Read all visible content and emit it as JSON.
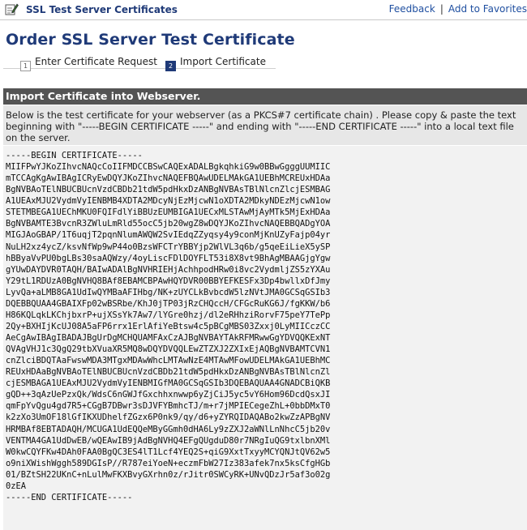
{
  "header": {
    "app_title": "SSL Test Server Certificates",
    "links": [
      "Feedback",
      "Add to Favorites"
    ]
  },
  "page": {
    "title": "Order SSL Server Test Certificate"
  },
  "steps": [
    {
      "number": "1",
      "label": "Enter Certificate Request",
      "active": false
    },
    {
      "number": "2",
      "label": "Import Certificate",
      "active": true
    }
  ],
  "section": {
    "title": "Import Certificate into Webserver.",
    "description": "Below is the test certificate for your webserver (as a PKCS#7 certificate chain) . Please copy & paste the text beginning with \"-----BEGIN CERTIFICATE -----\" and ending with \"-----END CERTIFICATE -----\" into a local text file on the server."
  },
  "certificate": {
    "lines": [
      "-----BEGIN CERTIFICATE-----",
      "MIIFPwYJKoZIhvcNAQcCoIIFMDCCBSwCAQExADALBgkqhkiG9w0BBwGgggUUMIIC",
      "mTCCAgKgAwIBAgICRyEwDQYJKoZIhvcNAQEFBQAwUDELMAkGA1UEBhMCREUxHDAa",
      "BgNVBAoTElNBUCBUcnVzdCBDb21tdW5pdHkxDzANBgNVBAsTBlNlcnZlcjESMBAG",
      "A1UEAxMJU2VydmVyIENBMB4XDTA2MDcyNjEzMjcwN1oXDTA2MDkyNDEzMjcwN1ow",
      "STETMBEGA1UEChMKU0FQIFdlYiBBUzEUMBIGA1UECxMLSTAwMjAyMTk5MjExHDAa",
      "BgNVBAMTE3BvcnR3ZWluLmRld55ocC5jb20wgZ8wDQYJKoZIhvcNAQEBBQADgYOA",
      "MIGJAoGBAP/1T6uqjT2pqnNlumAWQW2SvIEdqZZyqsy4y9conMjKnUZyFajp04yr",
      "NuLH2xz4ycZ/ksvNfWp9wP44o0BzsWFCTrYBBYjp2WlVL3q6b/g5qeEiLieX5ySP",
      "hBByaVvPU0bgLBs30saAQWzy/4oyLiscFDlDOYFLT53i8X8vt9BhAgMBAAGjgYgw",
      "gYUwDAYDVR0TAQH/BAIwADAlBgNVHRIEHjAchhpodHRw0i8vc2VydmljZS5zYXAu",
      "Y29tL1RDUzA0BgNVHQ8BAf8EBAMCBPAwHQYDVR00BBYEFKESFx3Dp4bwllxDfJmy",
      "LyvQa+aLMB8GA1UdIwQYMBaAFIHbg/NK+zUYCLkBvbcdW5lzNVtJMA0GCSqGSIb3",
      "DQEBBQUAA4GBAIXFp02wBSRbe/KhJ0jTP03jRzCHQccH/CFGcRuKG6J/fgKKW/b6",
      "H86KQLqkLKChjbxrP+ujXSsYk7Aw7/lYGre0hzj/dl2eRHhziRorvF75peY7TePp",
      "2Qy+BXHIjKcUJ08A5aFP6rrx1ErlAfiYeBtsw4c5pBCgMBS03Zxxj0LyMIICczCC",
      "AeCgAwIBAgIBADAJBgUrDgMCHQUAMFAxCzAJBgNVBAYTAkRFMRwwGgYDVQQKExNT",
      "QVAgVHJ1c3QgQ29tbXVuaXR5MQ8wDQYDVQQLEwZTZXJ2ZXIxEjAQBgNVBAMTCVN1",
      "cnZlciBDQTAaFwswMDA3MTgxMDAwWhcLMTAwNzE4MTAwMFowUDELMAkGA1UEBhMC",
      "REUxHDAaBgNVBAoTElNBUCBUcnVzdCBDb21tdW5pdHkxDzANBgNVBAsTBlNlcnZl",
      "cjESMBAGA1UEAxMJU2VydmVyIENBMIGfMA0GCSqGSIb3DQEBAQUAA4GNADCBiQKB",
      "gQD++3qAzUePzxQk/WdsC6nGWJfGxchhxnwwp6yZjCiJ5yc5vY6Hom96DcdQsxJI",
      "qmFpYvQgu4gd7R5+CGgB7DBwr3sDJVFYBmhcTJ/m+r7jMPIECegeZhL+0bbDMxT0",
      "k2zXo3UmOF18lGfIKXUDhelfZGzx6P0nk9/qy/d6+yZYRQIDAQABo2kwZzAPBgNV",
      "HRMBAf8EBTADAQH/MCUGA1UdEQQeMByGGmh0dHA6Ly9zZXJ2aWNlLnNhcC5jb20v",
      "VENTMA4GA1UdDwEB/wQEAwIB9jAdBgNVHQ4EFgQUgduD80r7NRgIuQG9txlbnXMl",
      "W0kwCQYFKw4DAh0FAA0BgQC3ES4lT1Lcf4YEQ2S+qiG9XxtTxyyMCYQNJtQV62w5",
      "o9niXWishWggh589DGIsP//R787eiYoeN+eczmFbW27Iz383afek7nx5ksCfgHGb",
      "01/BZtSH22UKnC+nLulMwFKXBvyGXrhn0z/rJitr0SWCyRK+UNvQDzJr5af3o02g",
      "0zEA",
      "-----END CERTIFICATE-----"
    ]
  }
}
